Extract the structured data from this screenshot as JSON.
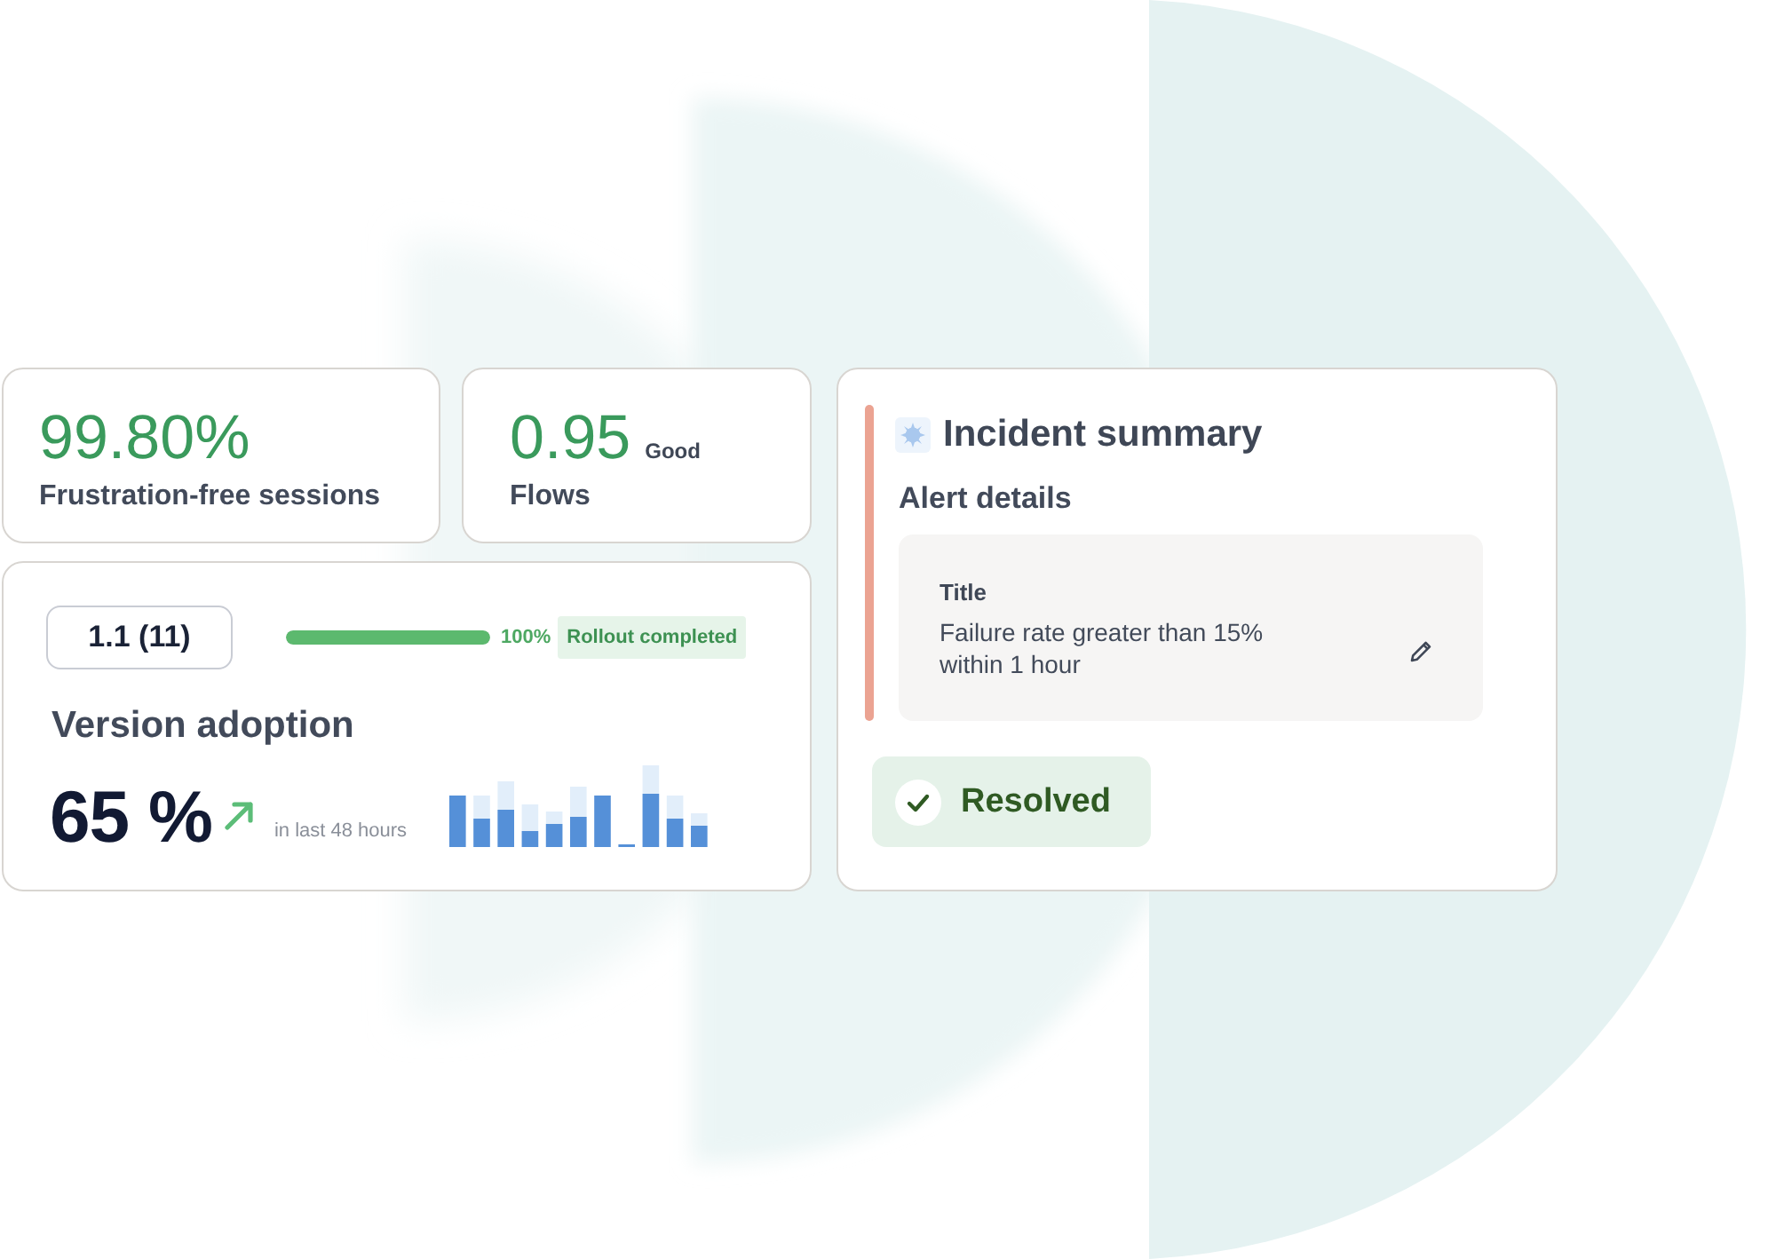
{
  "metrics": [
    {
      "value": "99.80%",
      "label": "Frustration-free sessions"
    },
    {
      "value": "0.95",
      "rating": "Good",
      "label": "Flows"
    }
  ],
  "version_adoption": {
    "version": "1.1 (11)",
    "rollout": {
      "level": 1,
      "percent": "100%",
      "status": "Rollout completed"
    },
    "title": "Version adoption",
    "value": "65 %",
    "period": "in last 48 hours"
  },
  "incident_summary": {
    "title": "Incident summary",
    "section": "Alert details",
    "alert": {
      "label": "Title",
      "value": "Failure rate greater than 15% within 1 hour"
    },
    "status": "Resolved"
  }
}
